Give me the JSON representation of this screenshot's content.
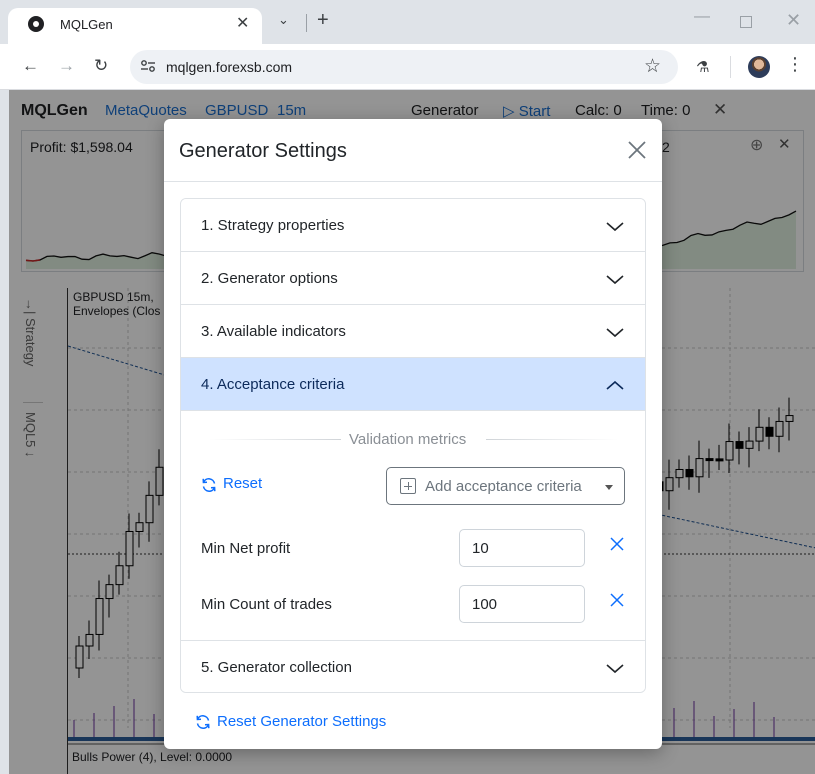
{
  "browser": {
    "tab_title": "MQLGen",
    "url": "mqlgen.forexsb.com",
    "icons": [
      "radiation-favicon",
      "close-icon",
      "chevron-down-icon",
      "plus-icon",
      "minimize-icon",
      "maximize-icon",
      "close-icon",
      "back-icon",
      "forward-icon",
      "reload-icon",
      "site-info-icon",
      "star-icon",
      "flask-icon",
      "avatar",
      "more-vert-icon"
    ]
  },
  "app": {
    "title": "MQLGen",
    "platform": "MetaQuotes",
    "symbol": "GBPUSD",
    "period": "15m",
    "mode": "Generator",
    "start_label": "▷ Start",
    "calc": "Calc: 0",
    "time": "Time: 0",
    "profit": "Profit: $1,598.04",
    "profit_right": "2",
    "chart_title": "GBPUSD 15m,",
    "chart_subtitle": "Envelopes (Clos",
    "bulls_label": "Bulls Power (4), Level: 0.0000",
    "side_strategy": "Strategy",
    "side_mql": "MQL5",
    "colors": {
      "accent": "#1a6fd0",
      "profit_up": "#2a7a2a",
      "profit_down": "#c62828",
      "volume": "#6b2fa0"
    }
  },
  "modal": {
    "title": "Generator Settings",
    "sections": [
      {
        "label": "1. Strategy properties",
        "open": false
      },
      {
        "label": "2. Generator options",
        "open": false
      },
      {
        "label": "3. Available indicators",
        "open": false
      },
      {
        "label": "4. Acceptance criteria",
        "open": true
      },
      {
        "label": "5. Generator collection",
        "open": false
      }
    ],
    "validation_label": "Validation metrics",
    "reset_label": "Reset",
    "add_criteria_label": "Add acceptance criteria",
    "criteria": [
      {
        "label": "Min Net profit",
        "value": "10"
      },
      {
        "label": "Min Count of trades",
        "value": "100"
      }
    ],
    "reset_generator_label": "Reset Generator Settings",
    "colors": {
      "link": "#0d6efd",
      "open_section_bg": "#cfe2ff"
    }
  }
}
